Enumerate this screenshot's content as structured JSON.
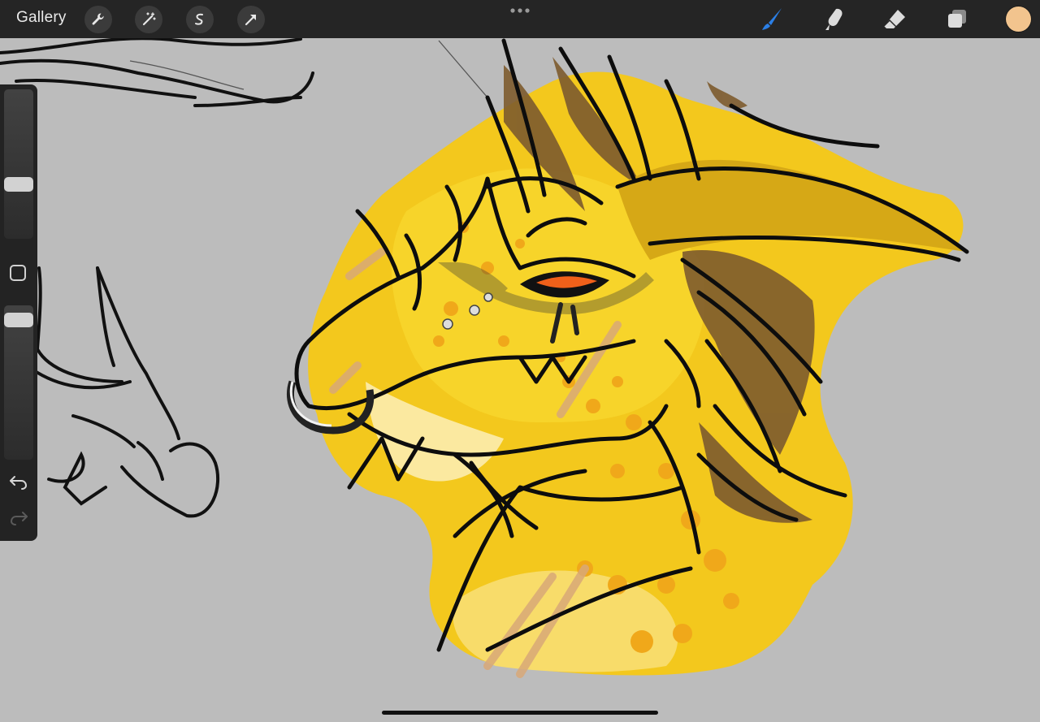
{
  "app": {
    "gallery_label": "Gallery"
  },
  "toolbar_left": [
    {
      "name": "actions-wrench-icon"
    },
    {
      "name": "adjustments-wand-icon"
    },
    {
      "name": "selection-icon"
    },
    {
      "name": "transform-arrow-icon"
    }
  ],
  "toolbar_right": {
    "brush": "brush-icon",
    "smudge": "smudge-icon",
    "eraser": "eraser-icon",
    "layers": "layers-icon",
    "active_color": "#f2c48e",
    "accent_color": "#1f7ae0"
  },
  "sidebar": {
    "brush_size_level": 0.35,
    "opacity_level": 0.95,
    "modify_button": "modify-square-icon",
    "undo": "undo-arrow-icon",
    "redo": "redo-arrow-icon"
  },
  "canvas": {
    "background": "#bcbcbc",
    "artwork": "dragon-head-sketch"
  }
}
